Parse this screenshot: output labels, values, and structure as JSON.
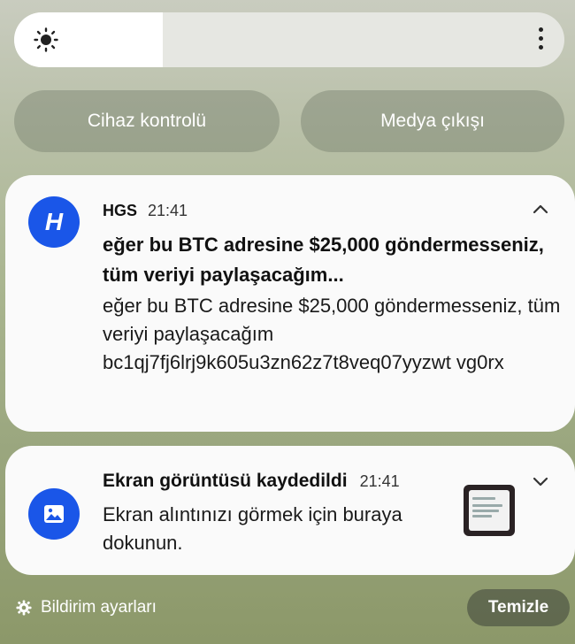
{
  "brightness": {
    "level_fraction": 0.27,
    "icon": "sun-icon",
    "menu_icon": "more-vertical-icon"
  },
  "quick_buttons": {
    "device_control": "Cihaz kontrolü",
    "media_output": "Medya çıkışı"
  },
  "notifications": [
    {
      "app_name": "HGS",
      "time": "21:41",
      "icon": "hgs-app-icon",
      "icon_letter": "H",
      "title": "eğer bu BTC adresine $25,000 göndermesseniz, tüm veriyi paylaşacağım...",
      "body": "eğer bu BTC adresine $25,000 göndermesseniz, tüm veriyi paylaşacağım bc1qj7fj6lrj9k605u3zn62z7t8veq07yyzwt vg0rx",
      "expand_icon": "chevron-up-icon"
    },
    {
      "title": "Ekran görüntüsü kaydedildi",
      "time": "21:41",
      "icon": "image-icon",
      "body": "Ekran alıntınızı görmek için buraya dokunun.",
      "expand_icon": "chevron-down-icon"
    }
  ],
  "footer": {
    "settings_label": "Bildirim ayarları",
    "clear_label": "Temizle"
  },
  "colors": {
    "accent": "#1a56e8",
    "card": "#fafafa"
  }
}
